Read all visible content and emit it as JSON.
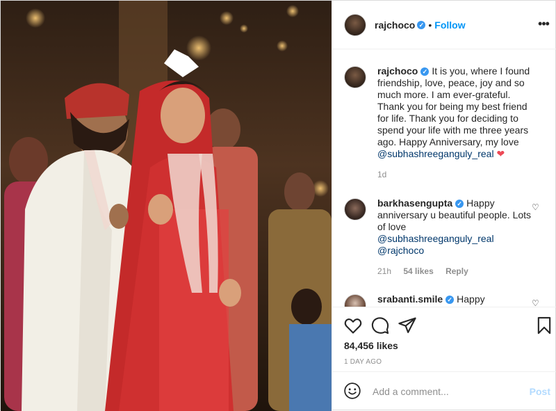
{
  "post": {
    "username": "rajchoco",
    "follow_label": "Follow",
    "more_icon": "more-horizontal-icon",
    "verified_icon": "verified-badge-icon"
  },
  "caption": {
    "username": "rajchoco",
    "text": "It is you, where I found friendship, love, peace, joy and so much more. I am ever-grateful. Thank you for being my best friend for life. Thank you for deciding to spend your life with me three years ago. Happy Anniversary, my love",
    "mention": "@subhashreeganguly_real",
    "age": "1d"
  },
  "comments": [
    {
      "username": "barkhasengupta",
      "line1": "Happy anniversary u beautiful people. Lots of love",
      "mention1": "@subhashreeganguly_real",
      "mention2": "@rajchoco",
      "age": "21h",
      "likes": "54 likes",
      "reply": "Reply"
    },
    {
      "username": "srabanti.smile",
      "line1": "Happy"
    }
  ],
  "actions": {
    "likes": "84,456 likes",
    "time": "1 DAY AGO"
  },
  "add_comment": {
    "placeholder": "Add a comment...",
    "post_label": "Post"
  },
  "colors": {
    "link": "#0095f6",
    "verified": "#3897f0",
    "heart": "#ed4956",
    "post_disabled": "#b3dbff"
  }
}
